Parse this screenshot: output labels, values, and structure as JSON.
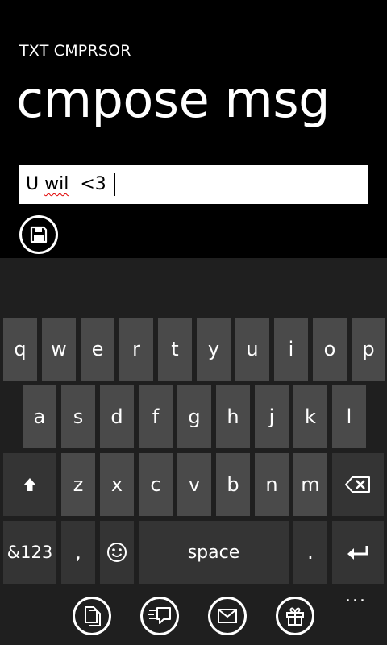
{
  "app_title": "TXT CMPRSOR",
  "page_title": "cmpose msg",
  "message": {
    "word1": "U",
    "word2": "wil",
    "word3": "<3"
  },
  "save_button_icon": "floppy-disk-icon",
  "keyboard": {
    "row1": [
      "q",
      "w",
      "e",
      "r",
      "t",
      "y",
      "u",
      "i",
      "o",
      "p"
    ],
    "row2": [
      "a",
      "s",
      "d",
      "f",
      "g",
      "h",
      "j",
      "k",
      "l"
    ],
    "row3": [
      "z",
      "x",
      "c",
      "v",
      "b",
      "n",
      "m"
    ],
    "symbols_label": "&123",
    "comma_label": ",",
    "space_label": "space",
    "period_label": ".",
    "shift_icon": "shift-arrow-icon",
    "backspace_icon": "backspace-icon",
    "emoji_icon": "emoji-icon",
    "enter_icon": "enter-icon"
  },
  "appbar": {
    "icons": [
      "copy-icon",
      "compress-message-icon",
      "email-icon",
      "gift-icon"
    ],
    "more_label": "..."
  },
  "colors": {
    "background": "#000000",
    "keyboard_bg": "#1f1f1f",
    "key": "#4a4a4a",
    "key_dark": "#343434",
    "spell_error": "#e00000"
  }
}
